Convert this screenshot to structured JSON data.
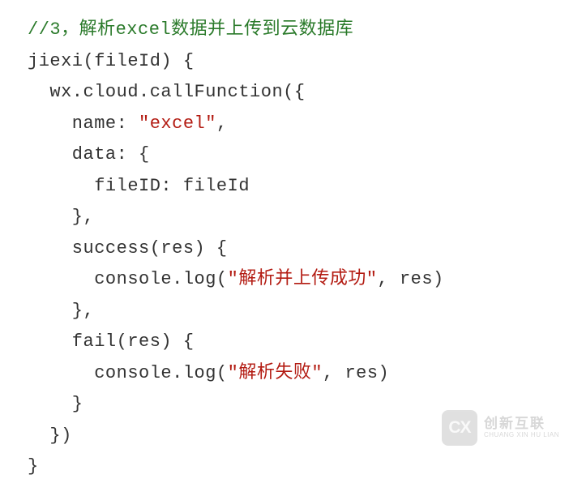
{
  "code": {
    "l1_comment": "//3，解析excel数据并上传到云数据库",
    "l2_a": "jiexi(fileId) {",
    "l3_a": "  wx.cloud.callFunction({",
    "l4_a": "    name: ",
    "l4_s": "\"excel\"",
    "l4_b": ",",
    "l5_a": "    data: {",
    "l6_a": "      fileID: fileId",
    "l7_a": "    },",
    "l8_a": "    success(res) {",
    "l9_a": "      console.log(",
    "l9_s": "\"解析并上传成功\"",
    "l9_b": ", res)",
    "l10_a": "    },",
    "l11_a": "    fail(res) {",
    "l12_a": "      console.log(",
    "l12_s": "\"解析失败\"",
    "l12_b": ", res)",
    "l13_a": "    }",
    "l14_a": "  })",
    "l15_a": "}"
  },
  "watermark": {
    "badge": "CX",
    "cn": "创新互联",
    "en": "CHUANG XIN HU LIAN"
  }
}
